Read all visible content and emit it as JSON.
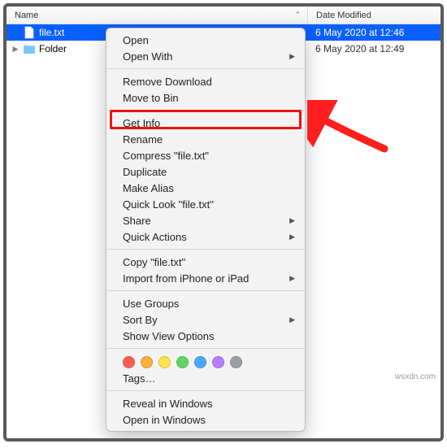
{
  "header": {
    "name_label": "Name",
    "date_label": "Date Modified"
  },
  "rows": [
    {
      "type": "file",
      "name": "file.txt",
      "date": "6 May 2020 at 12:46",
      "selected": true,
      "expandable": false
    },
    {
      "type": "folder",
      "name": "Folder",
      "date": "6 May 2020 at 12:49",
      "selected": false,
      "expandable": true
    }
  ],
  "menu": {
    "open": "Open",
    "open_with": "Open With",
    "remove_download": "Remove Download",
    "move_to_bin": "Move to Bin",
    "get_info": "Get Info",
    "rename": "Rename",
    "compress": "Compress \"file.txt\"",
    "duplicate": "Duplicate",
    "make_alias": "Make Alias",
    "quick_look": "Quick Look \"file.txt\"",
    "share": "Share",
    "quick_actions": "Quick Actions",
    "copy": "Copy \"file.txt\"",
    "import": "Import from iPhone or iPad",
    "use_groups": "Use Groups",
    "sort_by": "Sort By",
    "show_view_options": "Show View Options",
    "tags": "Tags…",
    "reveal": "Reveal in Windows",
    "open_in_windows": "Open in Windows"
  },
  "tag_colors": [
    "#ff5e57",
    "#ffae42",
    "#ffe14d",
    "#63d463",
    "#4aa8ff",
    "#b980ff",
    "#9aa0a6"
  ],
  "annotation": {
    "arrow_color": "#ff1f1f",
    "highlight_target": "get_info"
  },
  "watermark": "wsxdn.com"
}
